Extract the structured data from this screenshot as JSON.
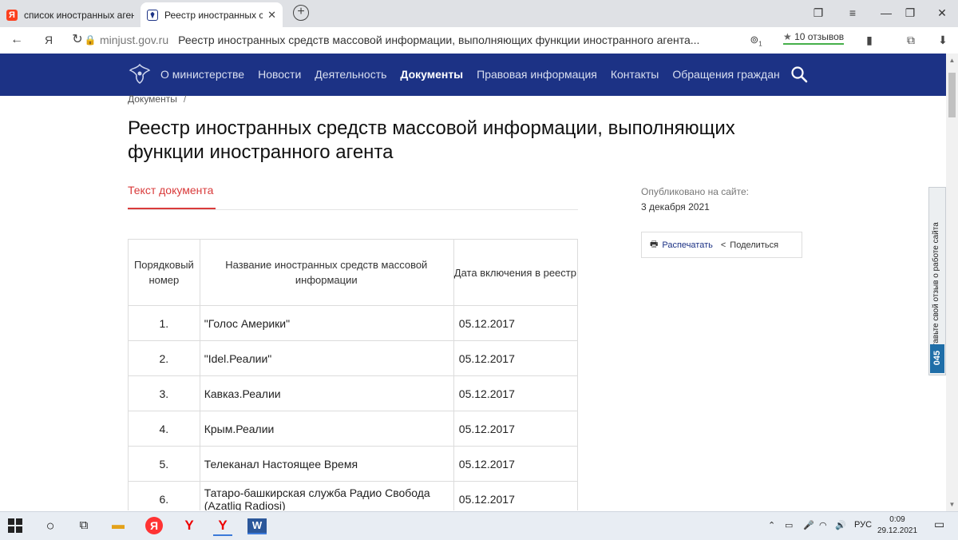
{
  "browser": {
    "tabs": [
      {
        "label": "список иностранных агентов",
        "favicon": "yandex-favicon",
        "active": false
      },
      {
        "label": "Реестр иностранных средств массовой информации",
        "favicon": "ministry-favicon",
        "active": true
      }
    ],
    "url_domain": "minjust.gov.ru",
    "url_title": "Реестр иностранных средств массовой информации, выполняющих функции иностранного агента...",
    "reviews": "10 отзывов",
    "badge_count": "1"
  },
  "site": {
    "menu": [
      {
        "label": "О министерстве",
        "active": false
      },
      {
        "label": "Новости",
        "active": false
      },
      {
        "label": "Деятельность",
        "active": false
      },
      {
        "label": "Документы",
        "active": true
      },
      {
        "label": "Правовая информация",
        "active": false
      },
      {
        "label": "Контакты",
        "active": false
      },
      {
        "label": "Обращения граждан",
        "active": false
      }
    ],
    "brand_color": "#1c3285"
  },
  "page": {
    "breadcrumb": "Документы",
    "breadcrumb_sep": "/",
    "title": "Реестр иностранных средств массовой информации, выполняющих функции иностранного агента",
    "doc_tab": "Текст документа",
    "published_caption": "Опубликовано на сайте:",
    "published_date": "3 декабря 2021",
    "print_label": "Распечатать",
    "share_label": "Поделиться",
    "accent_color": "#d93b3b"
  },
  "table": {
    "headers": [
      "Порядковый номер",
      "Название иностранных средств массовой информации",
      "Дата включения в реестр"
    ],
    "rows": [
      [
        "1.",
        "\"Голос Америки\"",
        "05.12.2017"
      ],
      [
        "2.",
        "\"Idel.Реалии\"",
        "05.12.2017"
      ],
      [
        "3.",
        "Кавказ.Реалии",
        "05.12.2017"
      ],
      [
        "4.",
        "Крым.Реалии",
        "05.12.2017"
      ],
      [
        "5.",
        "Телеканал Настоящее Время",
        "05.12.2017"
      ],
      [
        "6.",
        "Татаро-башкирская служба Радио Свобода (Azatliq Radiosi)",
        "05.12.2017"
      ],
      [
        "",
        "",
        ""
      ]
    ]
  },
  "feedback": {
    "text": "Оставьте свой отзыв о работе сайта",
    "number": "045"
  },
  "taskbar": {
    "lang": "РУС",
    "time": "0:09",
    "date": "29.12.2021"
  }
}
